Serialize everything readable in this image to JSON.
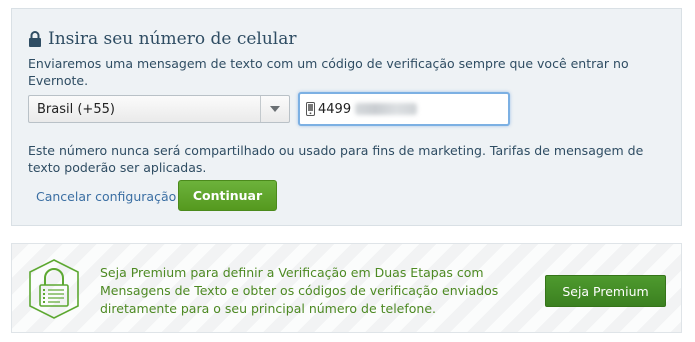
{
  "setup": {
    "title": "Insira seu número de celular",
    "description": "Enviaremos uma mensagem de texto com um código de verificação sempre que você entrar no Evernote.",
    "country_select": {
      "value": "Brasil (+55)"
    },
    "phone_input": {
      "value": "4499"
    },
    "note": "Este número nunca será compartilhado ou usado para fins de marketing. Tarifas de mensagem de texto poderão ser aplicadas.",
    "cancel_label": "Cancelar configuração",
    "continue_label": "Continuar"
  },
  "premium": {
    "text": "Seja Premium para definir a Verificação em Duas Etapas com Mensagens de Texto e obter os códigos de verificação enviados diretamente para o seu principal número de telefone.",
    "button_label": "Seja Premium"
  },
  "icons": {
    "title_icon": "lock-icon",
    "select_icon": "chevron-down-icon",
    "phone_icon": "mobile-phone-icon",
    "premium_icon": "premium-lock-badge-icon"
  },
  "colors": {
    "accent_green": "#55991f",
    "premium_green": "#3b8020",
    "link_blue": "#3b6fa3",
    "focus_blue": "#7cb0e3",
    "panel_bg": "#eef2f5"
  }
}
